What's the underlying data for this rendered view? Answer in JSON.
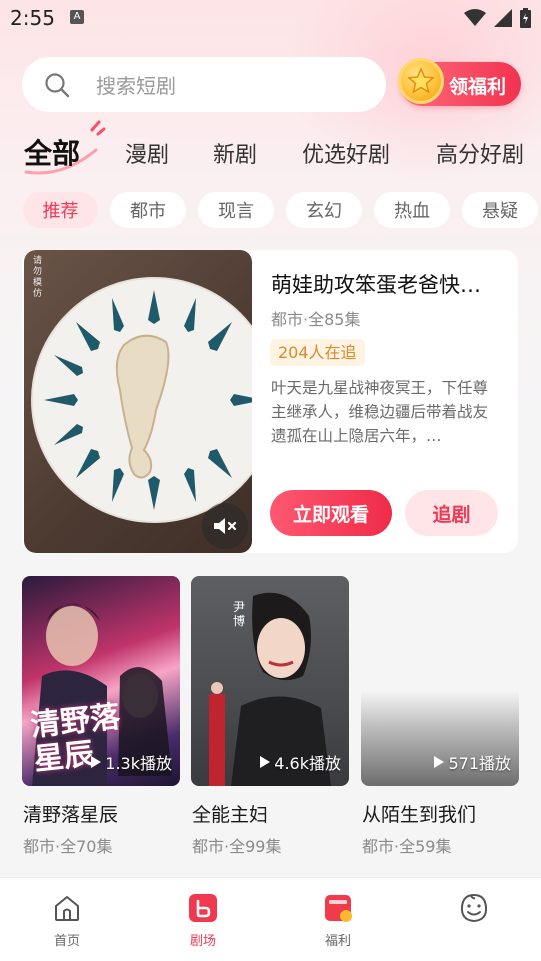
{
  "status_bar": {
    "time": "2:55",
    "notification_badge": "A"
  },
  "search": {
    "placeholder": "搜索短剧"
  },
  "welfare_button": {
    "label": "领福利"
  },
  "category_tabs": [
    "全部",
    "漫剧",
    "新剧",
    "优选好剧",
    "高分好剧"
  ],
  "genre_chips": [
    "推荐",
    "都市",
    "现言",
    "玄幻",
    "热血",
    "悬疑"
  ],
  "featured": {
    "title": "萌娃助攻笨蛋老爸快…",
    "meta": "都市·全85集",
    "followers_badge": "204人在追",
    "description": "叶天是九星战神夜冥王，下任尊主继承人，维稳边疆后带着战友遗孤在山上隐居六年，…",
    "watermark": "请勿模仿",
    "watch_label": "立即观看",
    "follow_label": "追剧"
  },
  "dramas": [
    {
      "name": "清野落星辰",
      "meta": "都市·全70集",
      "plays": "1.3k播放",
      "cover_text": "清野落星辰"
    },
    {
      "name": "全能主妇",
      "meta": "都市·全99集",
      "plays": "4.6k播放",
      "cover_text": "尹博"
    },
    {
      "name": "从陌生到我们",
      "meta": "都市·全59集",
      "plays": "571播放",
      "cover_text": ""
    }
  ],
  "bottom_nav": [
    {
      "label": "首页",
      "icon": "home-icon"
    },
    {
      "label": "剧场",
      "icon": "theater-icon"
    },
    {
      "label": "福利",
      "icon": "gift-icon"
    },
    {
      "label": "",
      "icon": "profile-avatar-icon"
    }
  ],
  "colors": {
    "accent": "#ee3a55",
    "badge_bg": "#fff4e3",
    "badge_text": "#d98a2a"
  }
}
